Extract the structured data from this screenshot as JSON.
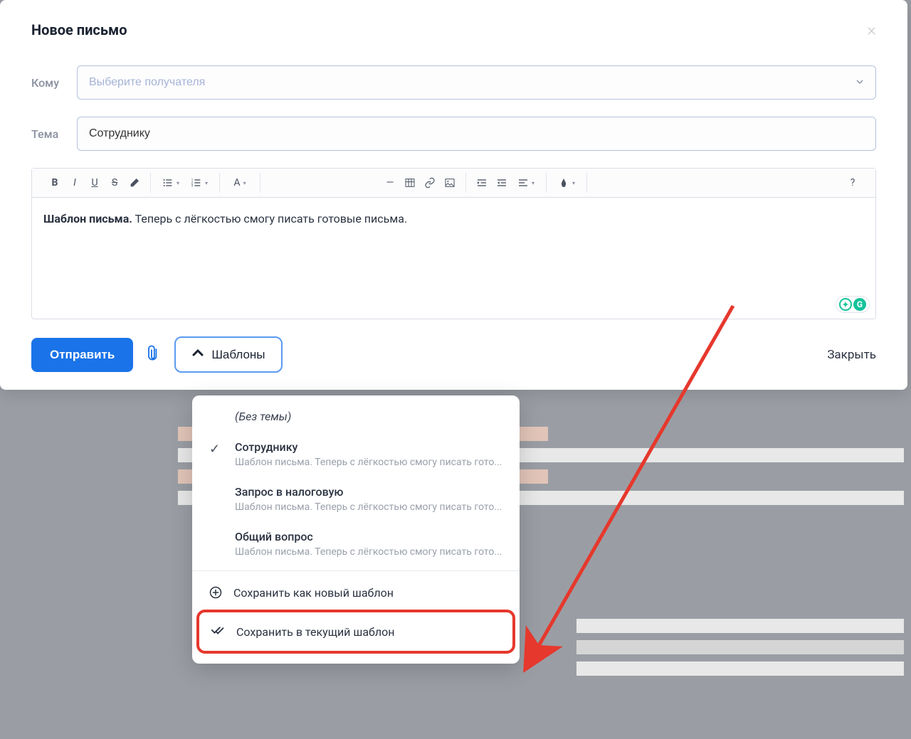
{
  "modal": {
    "title": "Новое письмо",
    "form": {
      "to_label": "Кому",
      "to_placeholder": "Выберите получателя",
      "subject_label": "Тема",
      "subject_value": "Сотруднику"
    },
    "editor": {
      "body_bold": "Шаблон письма.",
      "body_rest": " Теперь с лёгкостью смогу писать готовые письма."
    },
    "footer": {
      "send_label": "Отправить",
      "templates_label": "Шаблоны",
      "close_label": "Закрыть"
    }
  },
  "dropdown": {
    "items": [
      {
        "title": "(Без темы)",
        "italic": true,
        "subtitle": "",
        "checked": false
      },
      {
        "title": "Сотруднику",
        "italic": false,
        "subtitle": "Шаблон письма. Теперь с лёгкостью смогу писать гото...",
        "checked": true
      },
      {
        "title": "Запрос в налоговую",
        "italic": false,
        "subtitle": "Шаблон письма. Теперь с лёгкостью смогу писать гото...",
        "checked": false
      },
      {
        "title": "Общий вопрос",
        "italic": false,
        "subtitle": "Шаблон письма. Теперь с лёгкостью смогу писать гото...",
        "checked": false
      }
    ],
    "save_new_label": "Сохранить как новый шаблон",
    "save_current_label": "Сохранить в текущий шаблон"
  },
  "toolbar_help": "?"
}
